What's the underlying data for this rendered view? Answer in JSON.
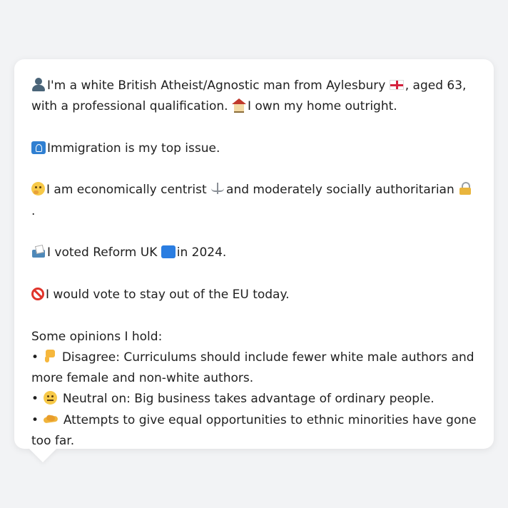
{
  "profile": {
    "intro_text_1": "I'm a white British Atheist/Agnostic man from Aylesbury",
    "intro_text_2": ", aged 63, with a professional qualification.",
    "intro_text_3": "I own my home outright.",
    "immigration_text": "Immigration is my top issue.",
    "ideology_text_1": "I am economically centrist",
    "ideology_text_2": "and moderately socially authoritarian",
    "ideology_text_3": ".",
    "vote_text_1": "I voted Reform UK",
    "vote_text_2": "in 2024.",
    "eu_text": "I would vote to stay out of the EU today.",
    "opinions_heading": "Some opinions I hold:",
    "opinions": [
      {
        "bullet": "•",
        "icon": "thumbs-down-icon",
        "text": "Disagree: Curriculums should include fewer white male authors and more female and non-white authors."
      },
      {
        "bullet": "•",
        "icon": "neutral-face-icon",
        "text": "Neutral on: Big business takes advantage of ordinary people."
      },
      {
        "bullet": "•",
        "icon": "handshake-icon",
        "text": "Attempts to give equal opportunities to ethnic minorities have gone too far."
      }
    ]
  },
  "icons": {
    "person": "bust-silhouette-icon",
    "flag": "england-flag-icon",
    "house": "house-icon",
    "passport": "passport-control-icon",
    "thinking": "thinking-face-icon",
    "scale": "balance-scale-icon",
    "lock": "lock-icon",
    "ballot": "ballot-box-icon",
    "party": "blue-square-icon",
    "no_entry": "prohibited-icon"
  },
  "colors": {
    "background": "#f2f3f5",
    "card": "#ffffff",
    "text": "#1f1f1f"
  }
}
